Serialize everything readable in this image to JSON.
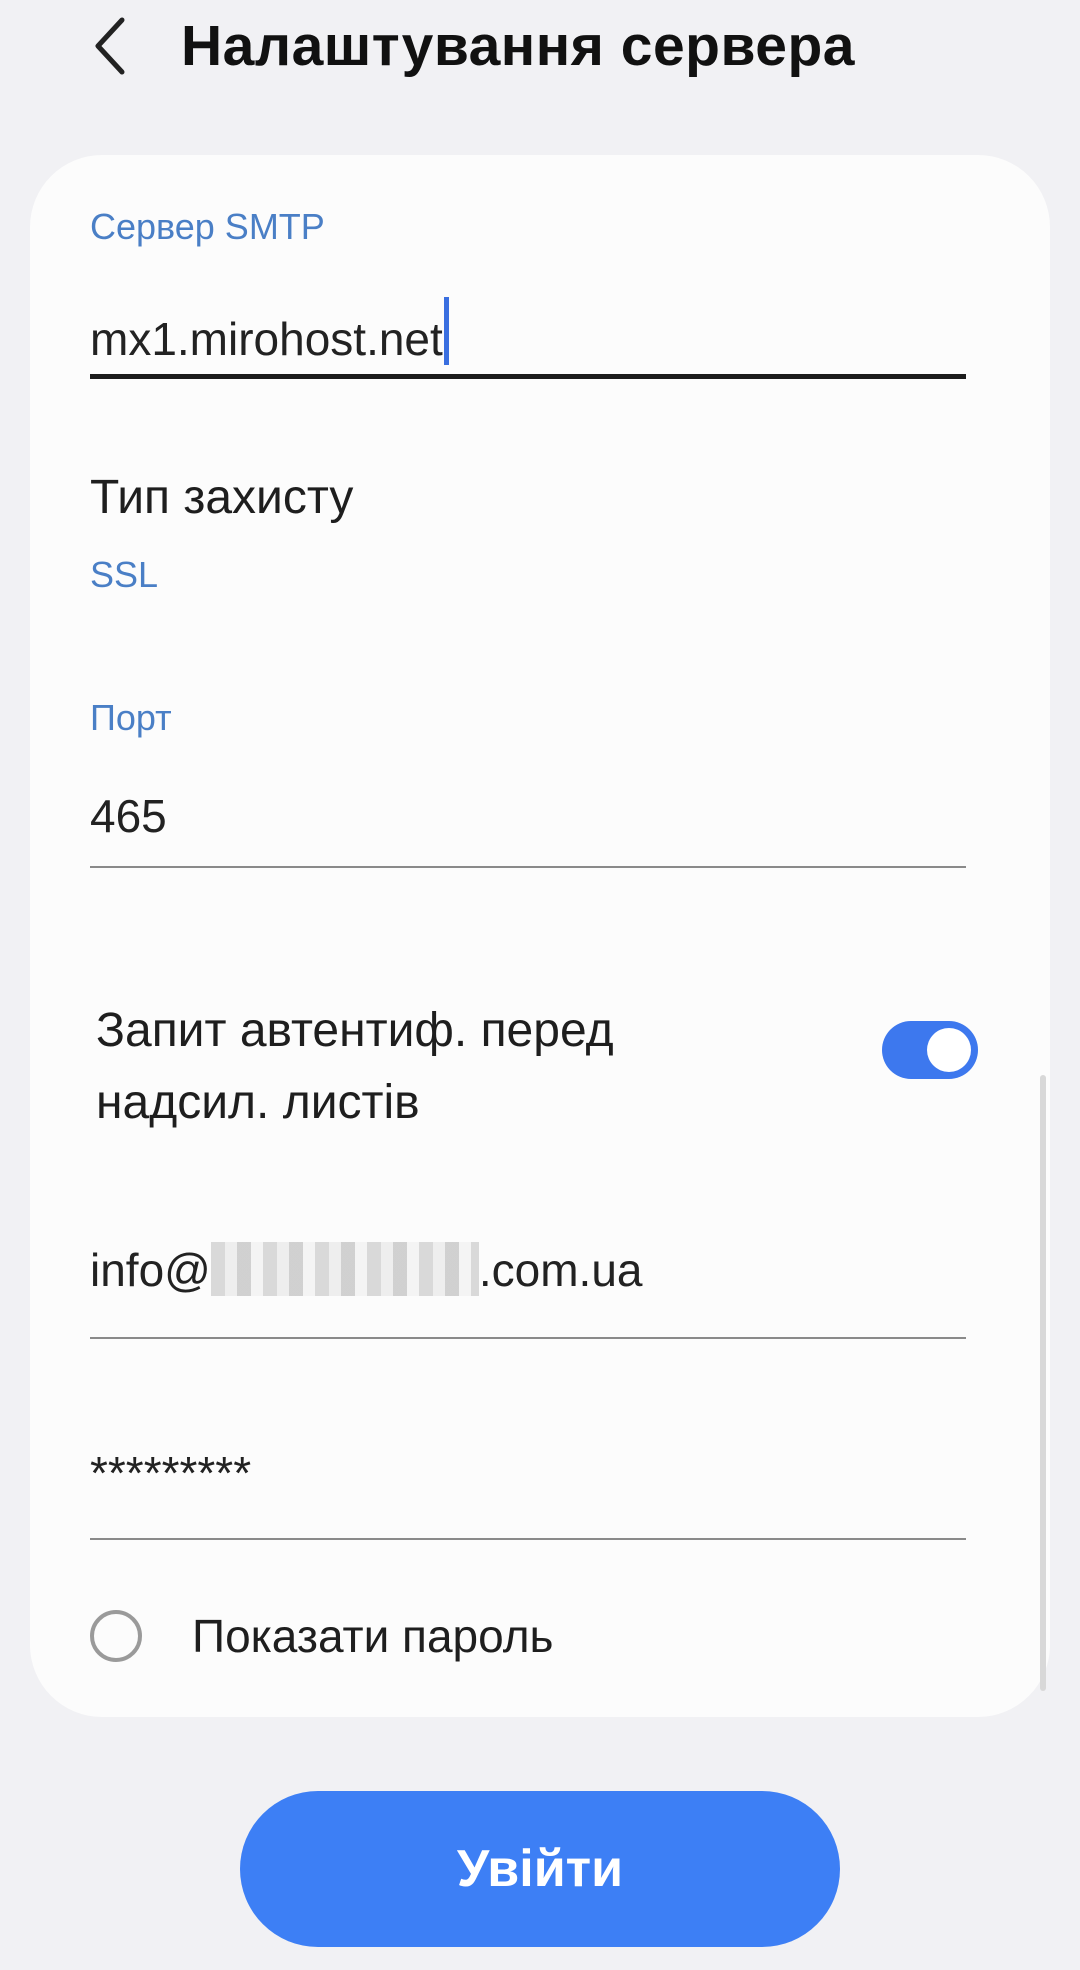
{
  "header": {
    "title": "Налаштування сервера",
    "back_icon": "chevron-left-icon"
  },
  "smtp": {
    "label": "Сервер SMTP",
    "value": "mx1.mirohost.net"
  },
  "security": {
    "title": "Тип захисту",
    "value": "SSL"
  },
  "port": {
    "label": "Порт",
    "value": "465"
  },
  "auth_toggle": {
    "label": "Запит автентиф. перед надсил. листів",
    "enabled": true
  },
  "username": {
    "prefix": "info@",
    "suffix": ".com.ua"
  },
  "password": {
    "value": "*********"
  },
  "show_password": {
    "label": "Показати пароль",
    "checked": false
  },
  "login_button": {
    "label": "Увійти"
  },
  "colors": {
    "accent": "#3d7ff5",
    "label_blue": "#4a7fc6",
    "background": "#f1f1f4",
    "card": "#fcfcfc"
  }
}
